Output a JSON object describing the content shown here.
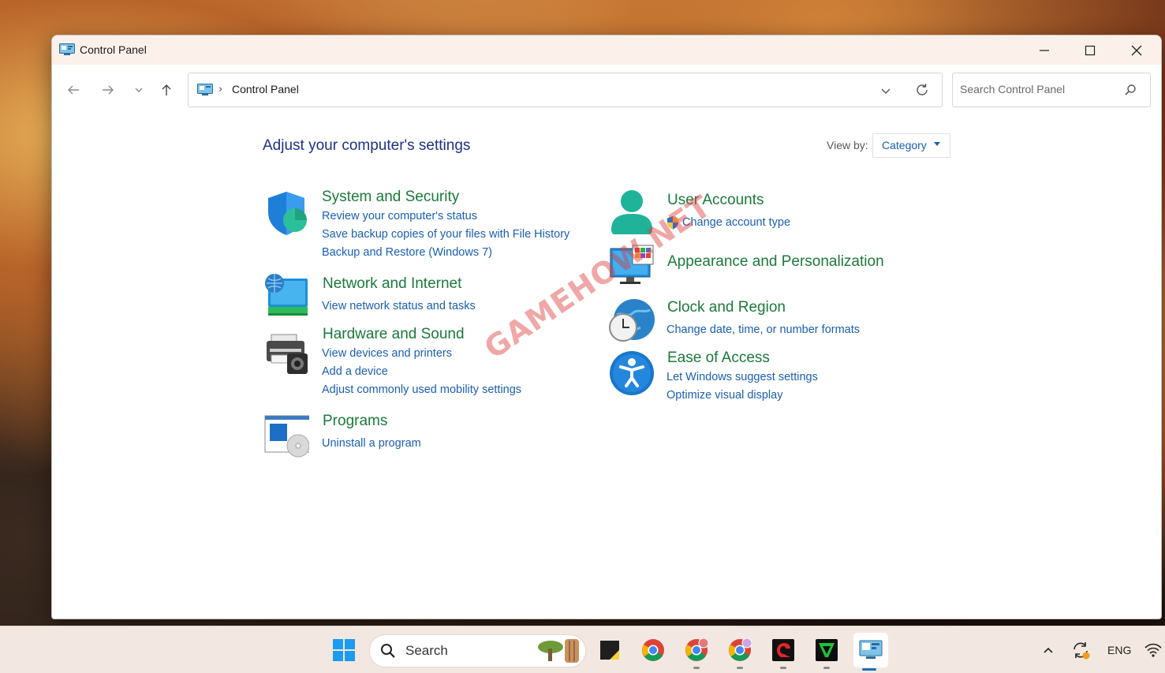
{
  "window": {
    "title": "Control Panel"
  },
  "navbar": {
    "breadcrumb": "Control Panel",
    "search_placeholder": "Search Control Panel"
  },
  "main": {
    "heading": "Adjust your computer's settings",
    "view_by_label": "View by:",
    "view_by_value": "Category",
    "categories": [
      {
        "icon": "shield-icon",
        "title": "System and Security",
        "links": [
          "Review your computer's status",
          "Save backup copies of your files with File History",
          "Backup and Restore (Windows 7)"
        ]
      },
      {
        "icon": "network-icon",
        "title": "Network and Internet",
        "links": [
          "View network status and tasks"
        ]
      },
      {
        "icon": "printer-icon",
        "title": "Hardware and Sound",
        "links": [
          "View devices and printers",
          "Add a device",
          "Adjust commonly used mobility settings"
        ]
      },
      {
        "icon": "programs-icon",
        "title": "Programs",
        "links": [
          "Uninstall a program"
        ]
      },
      {
        "icon": "user-icon",
        "title": "User Accounts",
        "links": [
          "Change account type"
        ]
      },
      {
        "icon": "appearance-icon",
        "title": "Appearance and Personalization",
        "links": []
      },
      {
        "icon": "clock-globe-icon",
        "title": "Clock and Region",
        "links": [
          "Change date, time, or number formats"
        ]
      },
      {
        "icon": "accessibility-icon",
        "title": "Ease of Access",
        "links": [
          "Let Windows suggest settings",
          "Optimize visual display"
        ]
      }
    ],
    "watermark": "GAMEHOW.NET"
  },
  "taskbar": {
    "search_label": "Search",
    "language": "ENG",
    "apps": [
      "windows-start-icon",
      "sticky-notes-icon",
      "chrome-icon",
      "chrome-profile-1-icon",
      "chrome-profile-2-icon",
      "garena-icon",
      "game-launcher-icon",
      "control-panel-icon"
    ]
  },
  "colors": {
    "heading": "#1e3287",
    "category_title": "#1b7a3a",
    "link": "#1a5fb4",
    "titlebar": "#fbf1ea",
    "taskbar": "#f3e8e1"
  }
}
